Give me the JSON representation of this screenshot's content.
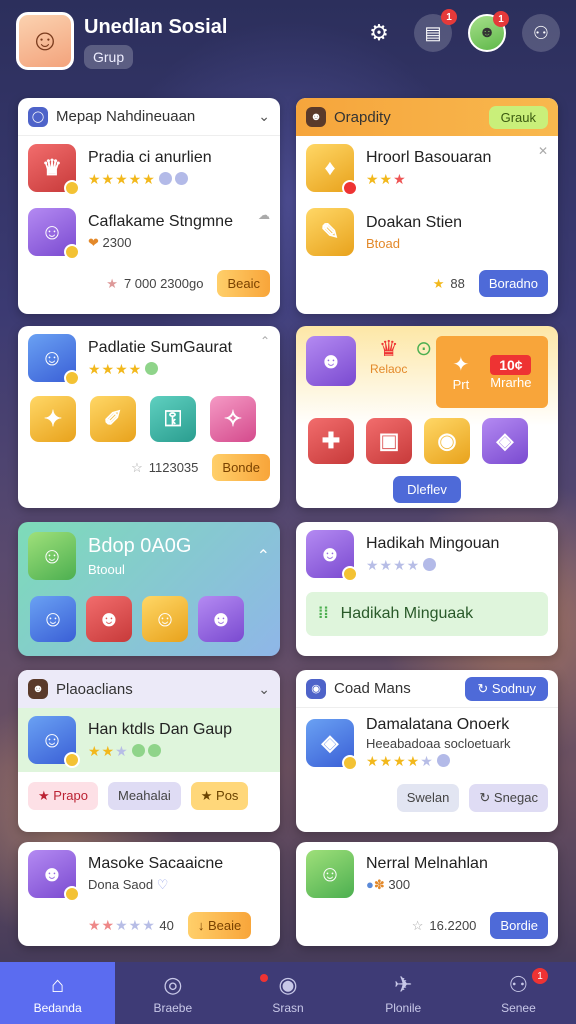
{
  "header": {
    "title": "Unedlan Sosial",
    "subtitle": "Grup",
    "avatar_letter": "☺",
    "notif_count_1": "1",
    "notif_count_2": "1"
  },
  "cards": {
    "c1": {
      "head": "Mepap Nahdineuaan",
      "items": [
        {
          "name": "Pradia ci anurlien"
        },
        {
          "name": "Caflakame Stngmne",
          "sub_prefix": "❤",
          "sub": "2300"
        }
      ],
      "stat": "7 000 2300go",
      "button": "Beaic"
    },
    "c2": {
      "head": "Orapdity",
      "pill": "Grauk",
      "items": [
        {
          "name": "Hroorl Basouaran"
        },
        {
          "name": "Doakan Stien",
          "sub": "Btoad"
        }
      ],
      "stat": "88",
      "button": "Boradno"
    },
    "c3": {
      "item": {
        "name": "Padlatie SumGaurat"
      },
      "stat": "1123035",
      "button": "Bonde"
    },
    "c4": {
      "label_1": "Relaoc",
      "label_2": "Prt",
      "label_3": "Mrarhe",
      "badge": "10¢",
      "button": "Dleflev"
    },
    "c5": {
      "title": "Bdop 0A0G",
      "sub": "Btooul"
    },
    "c6": {
      "item": {
        "name": "Hadikah Mingouan"
      },
      "button": "Hadikah Minguaak"
    },
    "c7": {
      "head": "Plaoaclians",
      "item": {
        "name": "Han ktdls Dan Gaup"
      },
      "buttons": [
        "Prapo",
        "Meahalai",
        "Pos"
      ]
    },
    "c8": {
      "head": "Coad Mans",
      "pill": "Sodnuy",
      "item": {
        "name": "Damalatana Onoerk",
        "sub": "Heeabadoaa socloetuark"
      },
      "buttons": [
        "Swelan",
        "Snegac"
      ]
    },
    "c9": {
      "item": {
        "name": "Masoke Sacaaicne",
        "sub": "Dona Saod"
      },
      "stat": "40",
      "button": "Beaie"
    },
    "c10": {
      "item": {
        "name": "Nerral Melnahlan",
        "sub": "300"
      },
      "stat": "16.2200",
      "button": "Bordie"
    }
  },
  "tabs": [
    {
      "label": "Bedanda",
      "icon": "home-icon"
    },
    {
      "label": "Braebe",
      "icon": "compass-icon"
    },
    {
      "label": "Srasn",
      "icon": "globe-icon"
    },
    {
      "label": "Plonile",
      "icon": "plane-icon"
    },
    {
      "label": "Senee",
      "icon": "profile-icon",
      "badge": "1"
    }
  ],
  "colors": {
    "accent": "#5b6cf0",
    "orange": "#f8a53a",
    "tabbar": "#3e3b76"
  }
}
